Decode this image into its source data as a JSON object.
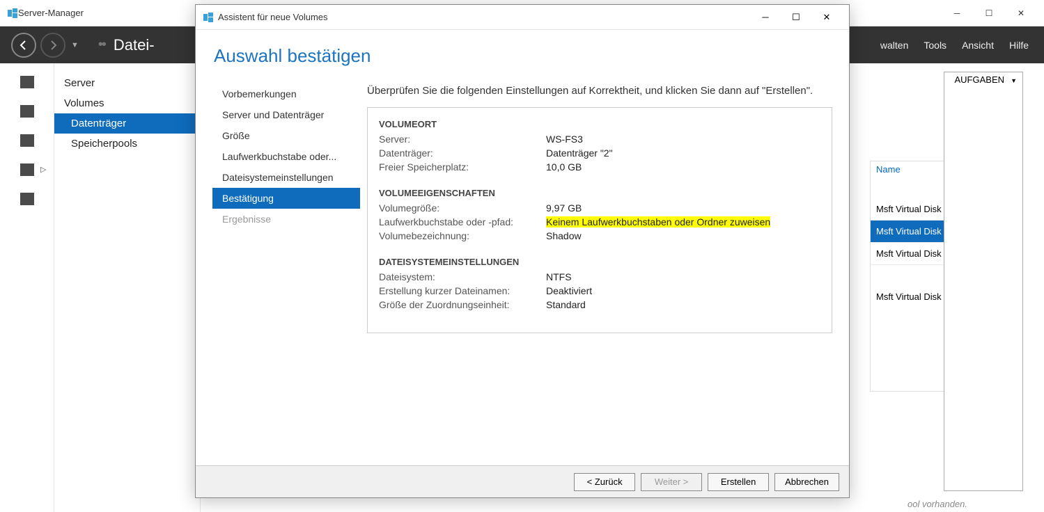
{
  "window": {
    "title": "Server-Manager",
    "breadcrumb_label": "Datei-",
    "breadcrumb_sep": "••"
  },
  "top_menu": {
    "manage": "walten",
    "tools": "Tools",
    "view": "Ansicht",
    "help": "Hilfe"
  },
  "side_nav": {
    "items": [
      "Server",
      "Volumes",
      "Datenträger",
      "Speicherpools"
    ]
  },
  "content": {
    "tasks_label": "AUFGABEN",
    "column_name": "Name",
    "disks": [
      "Msft Virtual Disk",
      "Msft Virtual Disk",
      "Msft Virtual Disk",
      "Msft Virtual Disk"
    ],
    "footer_note": "ool vorhanden."
  },
  "wizard": {
    "title": "Assistent für neue Volumes",
    "heading": "Auswahl bestätigen",
    "intro": "Überprüfen Sie die folgenden Einstellungen auf Korrektheit, und klicken Sie dann auf \"Erstellen\".",
    "steps": [
      "Vorbemerkungen",
      "Server und Datenträger",
      "Größe",
      "Laufwerkbuchstabe oder...",
      "Dateisystemeinstellungen",
      "Bestätigung",
      "Ergebnisse"
    ],
    "sections": {
      "volumeort": {
        "head": "VOLUMEORT",
        "server_k": "Server:",
        "server_v": "WS-FS3",
        "disk_k": "Datenträger:",
        "disk_v": "Datenträger \"2\"",
        "free_k": "Freier Speicherplatz:",
        "free_v": "10,0 GB"
      },
      "props": {
        "head": "VOLUMEEIGENSCHAFTEN",
        "size_k": "Volumegröße:",
        "size_v": "9,97 GB",
        "path_k": "Laufwerkbuchstabe oder -pfad:",
        "path_v": "Keinem Laufwerkbuchstaben oder Ordner zuweisen",
        "label_k": "Volumebezeichnung:",
        "label_v": "Shadow"
      },
      "fs": {
        "head": "DATEISYSTEMEINSTELLUNGEN",
        "fs_k": "Dateisystem:",
        "fs_v": "NTFS",
        "short_k": "Erstellung kurzer Dateinamen:",
        "short_v": "Deaktiviert",
        "alloc_k": "Größe der Zuordnungseinheit:",
        "alloc_v": "Standard"
      }
    },
    "buttons": {
      "back": "< Zurück",
      "next": "Weiter >",
      "create": "Erstellen",
      "cancel": "Abbrechen"
    }
  }
}
